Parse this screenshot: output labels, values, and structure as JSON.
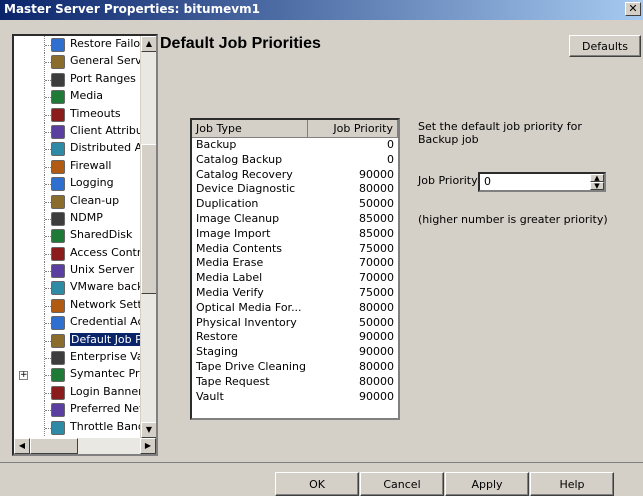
{
  "window": {
    "title": "Master Server Properties: bitumevm1",
    "close_glyph": "✕"
  },
  "tree": {
    "items": [
      {
        "label": "Restore Failov",
        "icon": "restore-failover-icon"
      },
      {
        "label": "General Server",
        "icon": "general-server-icon"
      },
      {
        "label": "Port Ranges",
        "icon": "port-ranges-icon"
      },
      {
        "label": "Media",
        "icon": "media-icon"
      },
      {
        "label": "Timeouts",
        "icon": "timeouts-icon"
      },
      {
        "label": "Client Attribute",
        "icon": "client-attributes-icon"
      },
      {
        "label": "Distributed App",
        "icon": "distributed-app-icon"
      },
      {
        "label": "Firewall",
        "icon": "firewall-icon"
      },
      {
        "label": "Logging",
        "icon": "logging-icon"
      },
      {
        "label": "Clean-up",
        "icon": "cleanup-icon"
      },
      {
        "label": "NDMP",
        "icon": "ndmp-icon"
      },
      {
        "label": "SharedDisk",
        "icon": "shareddisk-icon"
      },
      {
        "label": "Access Contro",
        "icon": "access-control-icon"
      },
      {
        "label": "Unix Server",
        "icon": "unix-server-icon"
      },
      {
        "label": "VMware backu",
        "icon": "vmware-backup-icon"
      },
      {
        "label": "Network Settin",
        "icon": "network-settings-icon"
      },
      {
        "label": "Credential Acc",
        "icon": "credential-access-icon"
      },
      {
        "label": "Default Job Pri",
        "icon": "default-job-priority-icon",
        "selected": true
      },
      {
        "label": "Enterprise Vau",
        "icon": "enterprise-vault-icon"
      },
      {
        "label": "Symantec Proc",
        "icon": "symantec-products-icon",
        "expandable": true
      },
      {
        "label": "Login Banner C",
        "icon": "login-banner-icon"
      },
      {
        "label": "Preferred Netv",
        "icon": "preferred-network-icon"
      },
      {
        "label": "Throttle Bandv",
        "icon": "throttle-bandwidth-icon"
      }
    ]
  },
  "main": {
    "title": "Default Job Priorities",
    "defaults_label": "Defaults",
    "table": {
      "headers": [
        "Job Type",
        "Job Priority"
      ],
      "rows": [
        [
          "Backup",
          "0"
        ],
        [
          "Catalog Backup",
          "0"
        ],
        [
          "Catalog Recovery",
          "90000"
        ],
        [
          "Device Diagnostic",
          "80000"
        ],
        [
          "Duplication",
          "50000"
        ],
        [
          "Image Cleanup",
          "85000"
        ],
        [
          "Image Import",
          "85000"
        ],
        [
          "Media Contents",
          "75000"
        ],
        [
          "Media Erase",
          "70000"
        ],
        [
          "Media Label",
          "70000"
        ],
        [
          "Media Verify",
          "75000"
        ],
        [
          "Optical Media For...",
          "80000"
        ],
        [
          "Physical Inventory",
          "50000"
        ],
        [
          "Restore",
          "90000"
        ],
        [
          "Staging",
          "90000"
        ],
        [
          "Tape Drive Cleaning",
          "80000"
        ],
        [
          "Tape Request",
          "80000"
        ],
        [
          "Vault",
          "90000"
        ]
      ]
    },
    "description": "Set the default job priority for Backup job",
    "priority_label": "Job Priority:",
    "priority_value": "0",
    "hint": "(higher number is greater priority)"
  },
  "footer": {
    "ok": "OK",
    "cancel": "Cancel",
    "apply": "Apply",
    "help": "Help"
  },
  "colors": {
    "title_gradient_start": "#0a246a",
    "title_gradient_end": "#a6caf0",
    "selection": "#0a246a",
    "dialog_bg": "#d4d0c8"
  }
}
